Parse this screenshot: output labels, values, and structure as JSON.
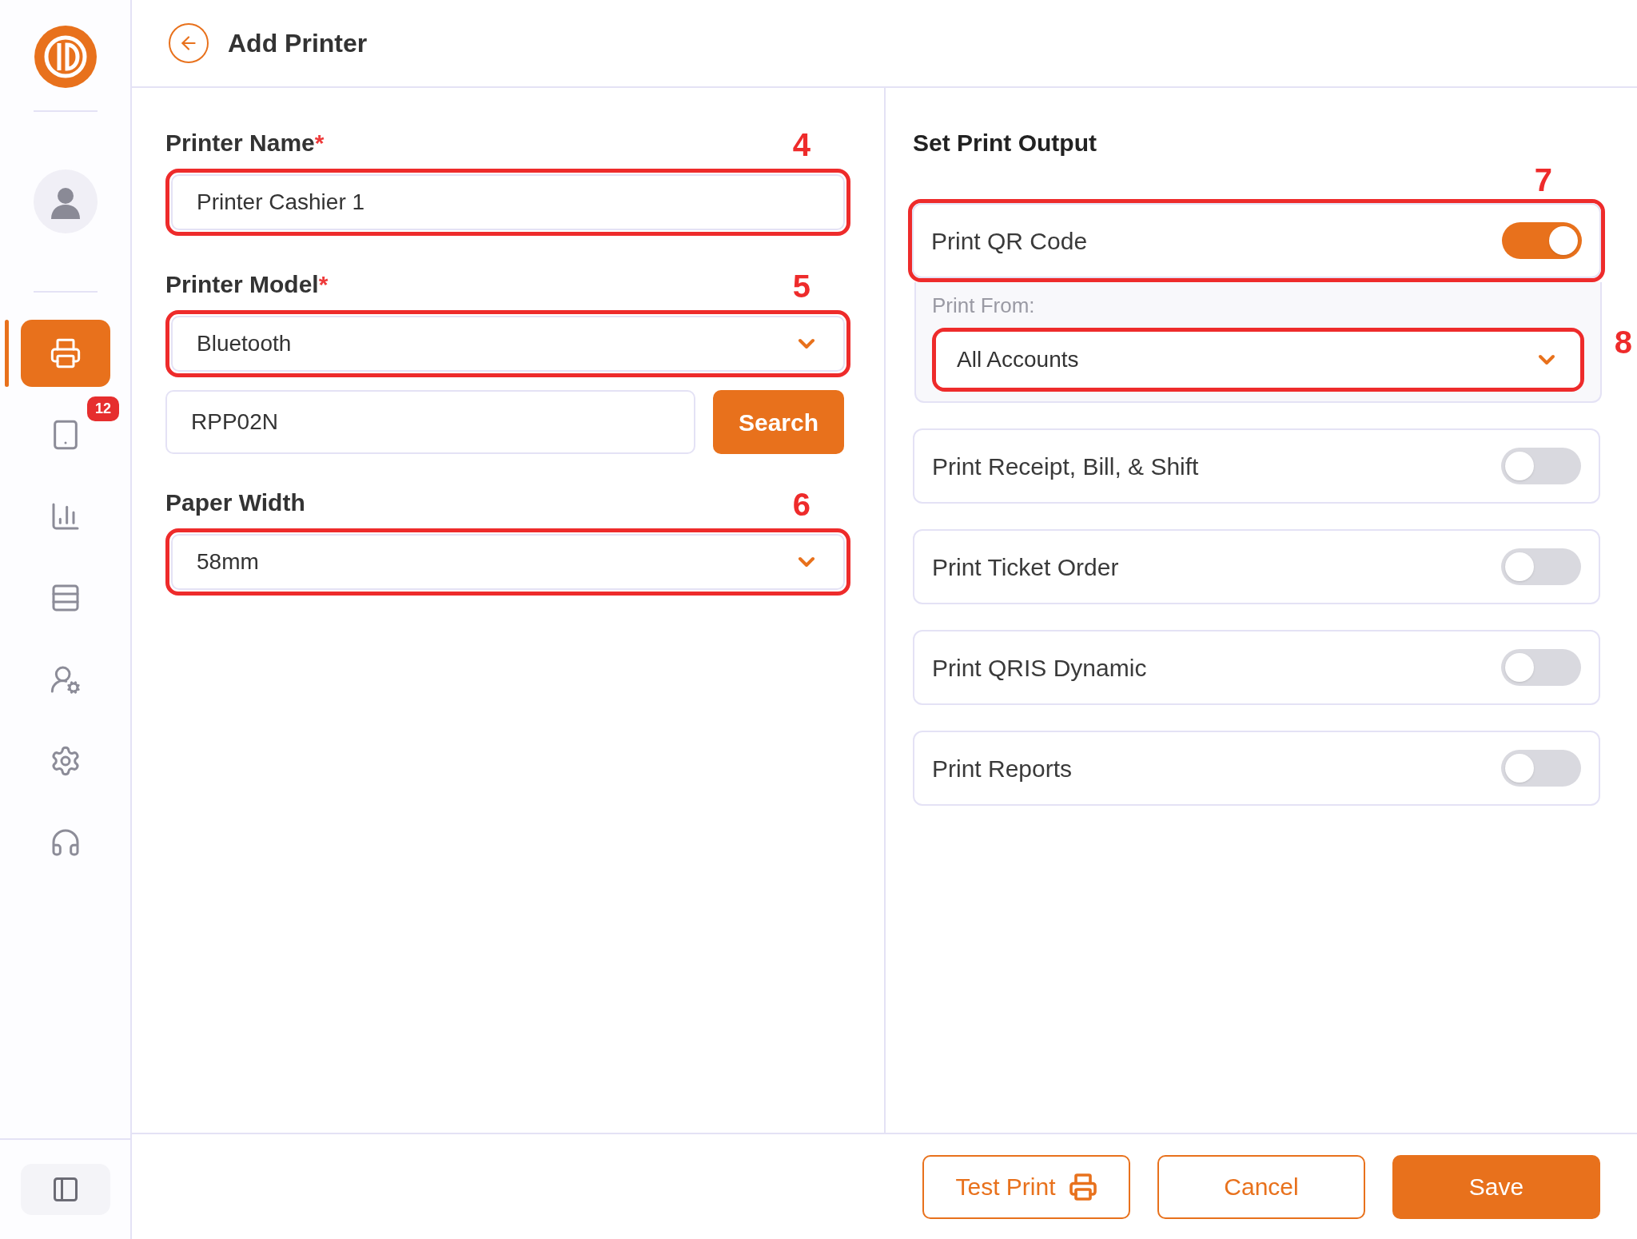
{
  "sidebar": {
    "items": [
      {
        "selected": true
      },
      {
        "selected": false,
        "badge": "12"
      },
      {
        "selected": false
      },
      {
        "selected": false
      },
      {
        "selected": false
      },
      {
        "selected": false
      },
      {
        "selected": false
      }
    ]
  },
  "header": {
    "title": "Add Printer"
  },
  "left": {
    "fields": [
      {
        "kind": "input",
        "label": "Printer Name",
        "required_mark": "*",
        "value": "Printer Cashier 1",
        "annotation": "4"
      },
      {
        "kind": "select",
        "label": "Printer Model",
        "required_mark": "*",
        "value": "Bluetooth",
        "annotation": "5",
        "search": {
          "value": "RPP02N",
          "button": "Search"
        }
      },
      {
        "kind": "select",
        "label": "Paper Width",
        "value": "58mm",
        "annotation": "6"
      }
    ]
  },
  "right": {
    "title": "Set Print Output",
    "options": [
      {
        "label": "Print QR Code",
        "on": true,
        "annotation": "7",
        "sub": {
          "label": "Print From:",
          "value": "All Accounts",
          "annotation": "8"
        }
      },
      {
        "label": "Print Receipt, Bill, & Shift",
        "on": false
      },
      {
        "label": "Print Ticket Order",
        "on": false
      },
      {
        "label": "Print QRIS Dynamic",
        "on": false
      },
      {
        "label": "Print Reports",
        "on": false
      }
    ]
  },
  "footer": {
    "buttons": [
      {
        "kind": "test",
        "label": "Test Print"
      },
      {
        "kind": "cancel",
        "label": "Cancel"
      },
      {
        "kind": "save",
        "label": "Save"
      }
    ]
  }
}
